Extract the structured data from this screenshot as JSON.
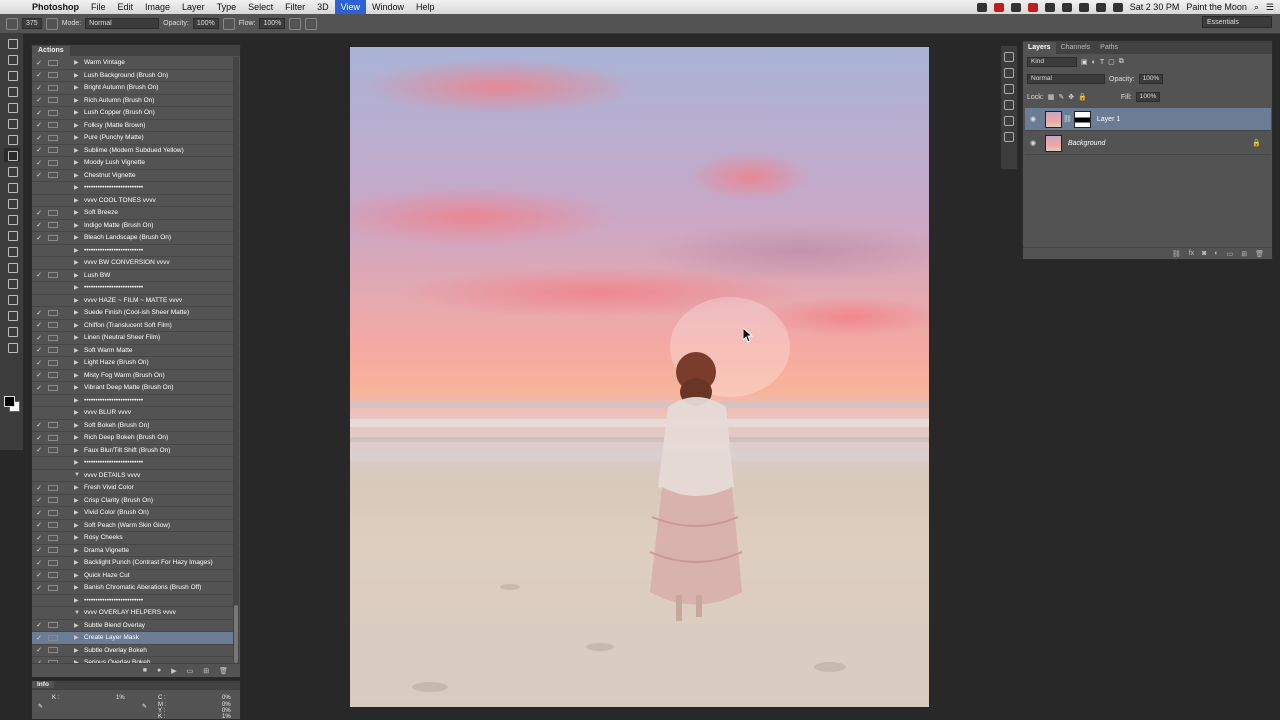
{
  "menubar": {
    "app": "Photoshop",
    "menus": [
      "File",
      "Edit",
      "Image",
      "Layer",
      "Type",
      "Select",
      "Filter",
      "3D",
      "View",
      "Window",
      "Help"
    ],
    "active_menu": "View",
    "clock": "Sat 2 30 PM",
    "user": "Paint the Moon"
  },
  "options_bar": {
    "brush_size": "375",
    "mode_label": "Mode:",
    "mode_value": "Normal",
    "opacity_label": "Opacity:",
    "opacity_value": "100%",
    "flow_label": "Flow:",
    "flow_value": "100%",
    "workspace": "Essentials"
  },
  "actions_panel": {
    "tab": "Actions",
    "items": [
      {
        "name": "Warm Vintage",
        "check": "✓",
        "type": "action"
      },
      {
        "name": "Lush Background (Brush On)",
        "check": "✓",
        "type": "action"
      },
      {
        "name": "Bright Autumn (Brush On)",
        "check": "✓",
        "type": "action"
      },
      {
        "name": "Rich Autumn (Brush On)",
        "check": "✓",
        "type": "action"
      },
      {
        "name": "Lush Copper (Brush On)",
        "check": "✓",
        "type": "action"
      },
      {
        "name": "Folksy (Matte Brown)",
        "check": "✓",
        "type": "action"
      },
      {
        "name": "Pure (Punchy Matte)",
        "check": "✓",
        "type": "action"
      },
      {
        "name": "Sublime (Modern Subdued Yellow)",
        "check": "✓",
        "type": "action"
      },
      {
        "name": "Moody Lush Vignette",
        "check": "✓",
        "type": "action"
      },
      {
        "name": "Chestnut Vignette",
        "check": "✓",
        "type": "action"
      },
      {
        "name": "••••••••••••••••••••••••••",
        "check": "",
        "type": "sep"
      },
      {
        "name": "vvvv  COOL TONES  vvvv",
        "check": "",
        "type": "sep"
      },
      {
        "name": "Soft Breeze",
        "check": "✓",
        "type": "action"
      },
      {
        "name": "Indigo Matte (Brush On)",
        "check": "✓",
        "type": "action"
      },
      {
        "name": "Bleach Landscape (Brush On)",
        "check": "✓",
        "type": "action"
      },
      {
        "name": "••••••••••••••••••••••••••",
        "check": "",
        "type": "sep"
      },
      {
        "name": "vvvv  BW CONVERSION  vvvv",
        "check": "",
        "type": "sep"
      },
      {
        "name": "Lush BW",
        "check": "✓",
        "type": "action"
      },
      {
        "name": "••••••••••••••••••••••••••",
        "check": "",
        "type": "sep"
      },
      {
        "name": "vvvv  HAZE ~ FILM ~ MATTE vvvv",
        "check": "",
        "type": "sep"
      },
      {
        "name": "Suede Finish (Cool-ish Sheer Matte)",
        "check": "✓",
        "type": "action"
      },
      {
        "name": "Chiffon (Translucent Soft Film)",
        "check": "✓",
        "type": "action"
      },
      {
        "name": "Linen (Neutral Sheer Film)",
        "check": "✓",
        "type": "action"
      },
      {
        "name": "Soft Warm Matte",
        "check": "✓",
        "type": "action"
      },
      {
        "name": "Light Haze (Brush On)",
        "check": "✓",
        "type": "action"
      },
      {
        "name": "Misty Fog Warm (Brush On)",
        "check": "✓",
        "type": "action"
      },
      {
        "name": "Vibrant Deep Matte (Brush On)",
        "check": "✓",
        "type": "action"
      },
      {
        "name": "••••••••••••••••••••••••••",
        "check": "",
        "type": "sep"
      },
      {
        "name": "vvvv  BLUR vvvv",
        "check": "",
        "type": "sep"
      },
      {
        "name": "Soft Bokeh (Brush On)",
        "check": "✓",
        "type": "action"
      },
      {
        "name": "Rich Deep Bokeh (Brush On)",
        "check": "✓",
        "type": "action"
      },
      {
        "name": "Faux Blur/Tilt Shift (Brush On)",
        "check": "✓",
        "type": "action"
      },
      {
        "name": "••••••••••••••••••••••••••",
        "check": "",
        "type": "sep"
      },
      {
        "name": "vvvv  DETAILS vvvv",
        "check": "",
        "type": "open"
      },
      {
        "name": "Fresh Vivid Color",
        "check": "✓",
        "type": "action"
      },
      {
        "name": "Crisp Clarity (Brush On)",
        "check": "✓",
        "type": "action"
      },
      {
        "name": "Vivid Color (Brush On)",
        "check": "✓",
        "type": "action"
      },
      {
        "name": "Soft Peach (Warm Skin Glow)",
        "check": "✓",
        "type": "action"
      },
      {
        "name": "Rosy Cheeks",
        "check": "✓",
        "type": "action"
      },
      {
        "name": "Drama Vignette",
        "check": "✓",
        "type": "action"
      },
      {
        "name": "Backlight Punch (Contrast For Hazy Images)",
        "check": "✓",
        "type": "action"
      },
      {
        "name": "Quick Haze Cut",
        "check": "✓",
        "type": "action"
      },
      {
        "name": "Banish Chromatic Aberations (Brush Off)",
        "check": "✓",
        "type": "action"
      },
      {
        "name": "••••••••••••••••••••••••••",
        "check": "",
        "type": "sep"
      },
      {
        "name": "vvvv  OVERLAY HELPERS vvvv",
        "check": "",
        "type": "open"
      },
      {
        "name": "Subtle Blend Overlay",
        "check": "✓",
        "type": "action"
      },
      {
        "name": "Create Layer Mask",
        "check": "✓",
        "type": "selected"
      },
      {
        "name": "Subtle Overlay Bokeh",
        "check": "✓",
        "type": "action"
      },
      {
        "name": "Serious Overlay Bokeh",
        "check": "✓",
        "type": "action"
      }
    ],
    "footer_icons": [
      "stop-icon",
      "record-icon",
      "play-icon",
      "folder-icon",
      "new-action-icon",
      "trash-icon"
    ]
  },
  "info_panel": {
    "tab": "Info",
    "k_label": "K :",
    "k_value": "1%",
    "c_label": "C :",
    "c_value": "0%",
    "m_label": "M :",
    "m_value": "0%",
    "y_label": "Y :",
    "y_value": "0%",
    "k2_label": "K :",
    "k2_value": "1%"
  },
  "layers_panel": {
    "tabs": [
      "Layers",
      "Channels",
      "Paths"
    ],
    "active_tab": "Layers",
    "kind_label": "Kind",
    "blend_mode": "Normal",
    "opacity_label": "Opacity:",
    "opacity_value": "100%",
    "lock_label": "Lock:",
    "fill_label": "Fill:",
    "fill_value": "100%",
    "layers": [
      {
        "name": "Layer 1",
        "selected": true,
        "has_mask": true
      },
      {
        "name": "Background",
        "selected": false,
        "locked": true
      }
    ]
  },
  "colors": {
    "selection": "#6b7c95",
    "panel_bg": "#535353",
    "menu_active": "#2c62d6"
  }
}
